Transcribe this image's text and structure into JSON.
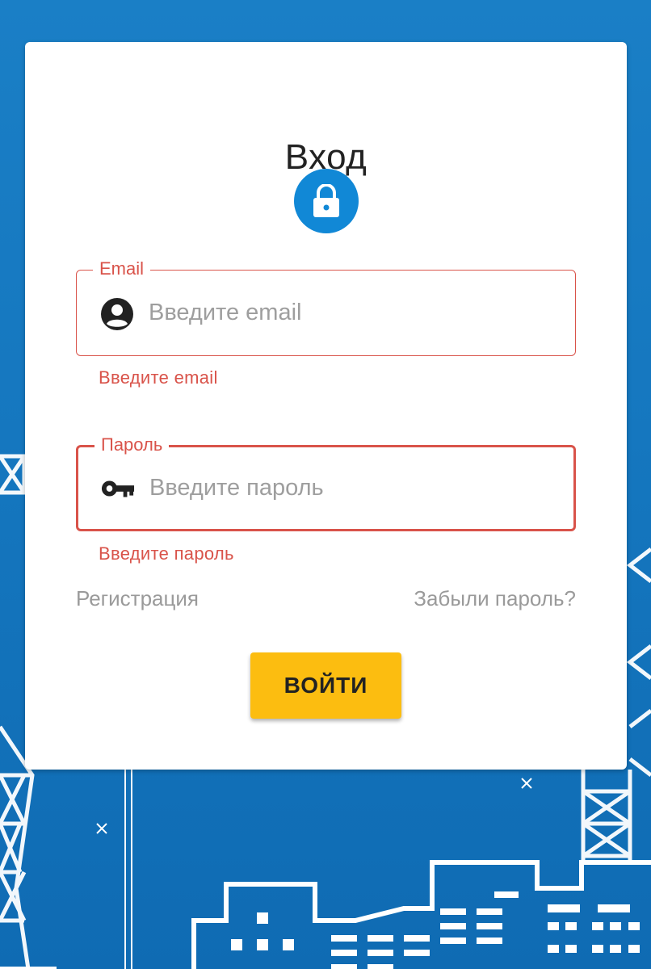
{
  "login": {
    "title": "Вход",
    "email": {
      "label": "Email",
      "placeholder": "Введите email",
      "value": "",
      "error": "Введите email",
      "icon": "account-circle-icon"
    },
    "password": {
      "label": "Пароль",
      "placeholder": "Введите пароль",
      "value": "",
      "error": "Введите пароль",
      "icon": "key-icon"
    },
    "register_link": "Регистрация",
    "forgot_link": "Забыли пароль?",
    "submit_label": "ВОЙТИ",
    "lock_icon": "lock-icon"
  },
  "colors": {
    "background": "#1577bf",
    "accent": "#1188d6",
    "error": "#d9534a",
    "button": "#fcbd10",
    "link": "#9a9a9a"
  }
}
